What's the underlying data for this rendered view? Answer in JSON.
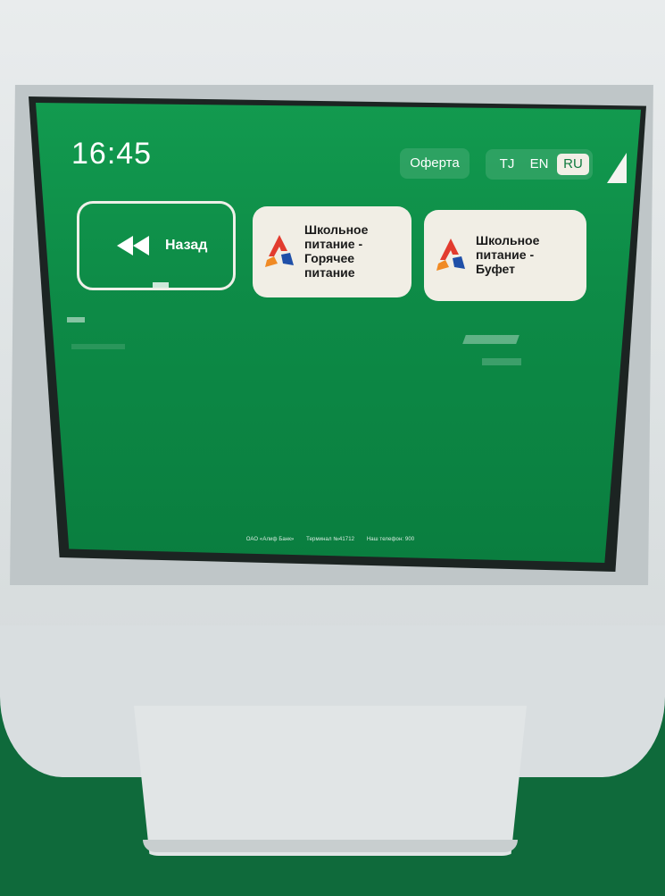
{
  "header": {
    "time": "16:45",
    "offer_label": "Оферта",
    "languages": [
      {
        "code": "TJ",
        "active": false
      },
      {
        "code": "EN",
        "active": false
      },
      {
        "code": "RU",
        "active": true
      }
    ]
  },
  "navigation": {
    "back_label": "Назад",
    "back_icon": "rewind-icon"
  },
  "services": [
    {
      "icon": "alif-logo-icon",
      "lines": [
        "Школьное",
        "питание -",
        "Горячее",
        "питание"
      ]
    },
    {
      "icon": "alif-logo-icon",
      "lines": [
        "Школьное",
        "питание -",
        "Буфет"
      ]
    }
  ],
  "footer": {
    "bank": "ОАО «Алиф Банк»",
    "terminal": "Терминал №41712",
    "phone": "Наш телефон: 900"
  },
  "colors": {
    "screen_green": "#0d8a46",
    "card_bg": "#f1eee5",
    "active_lang_bg": "#f2efe6",
    "logo_red": "#e23b2e",
    "logo_orange": "#f08a24",
    "logo_blue": "#1f4fa8"
  }
}
